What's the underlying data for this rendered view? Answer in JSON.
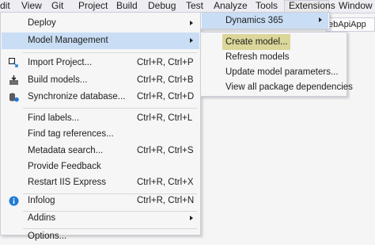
{
  "menubar": {
    "items": [
      "dit",
      "View",
      "Git",
      "Project",
      "Build",
      "Debug",
      "Test",
      "Analyze",
      "Tools",
      "Extensions",
      "Window"
    ],
    "active": "Extensions"
  },
  "background_tab": "ebApiApp",
  "main_menu": {
    "items": [
      {
        "label": "Deploy",
        "shortcut": "",
        "submenu": true
      },
      {
        "label": "Model Management",
        "shortcut": "",
        "submenu": true
      },
      {
        "label": "Import Project...",
        "shortcut": "Ctrl+R, Ctrl+P",
        "icon": "import-project-icon"
      },
      {
        "label": "Build models...",
        "shortcut": "Ctrl+R, Ctrl+B",
        "icon": "build-models-icon"
      },
      {
        "label": "Synchronize database...",
        "shortcut": "Ctrl+R, Ctrl+D",
        "icon": "synchronize-database-icon"
      },
      {
        "label": "Find labels...",
        "shortcut": "Ctrl+R, Ctrl+L"
      },
      {
        "label": "Find tag references...",
        "shortcut": ""
      },
      {
        "label": "Metadata search...",
        "shortcut": "Ctrl+R, Ctrl+S"
      },
      {
        "label": "Provide Feedback",
        "shortcut": ""
      },
      {
        "label": "Restart IIS Express",
        "shortcut": "Ctrl+R, Ctrl+X"
      },
      {
        "label": "Infolog",
        "shortcut": "Ctrl+R, Ctrl+N",
        "icon": "info-icon"
      },
      {
        "label": "Addins",
        "shortcut": "",
        "submenu": true
      },
      {
        "label": "Options...",
        "shortcut": ""
      }
    ]
  },
  "dynamics_menu": {
    "label": "Dynamics 365"
  },
  "model_menu": {
    "items": [
      "Create model...",
      "Refresh models",
      "Update model parameters...",
      "View all package dependencies"
    ]
  },
  "colors": {
    "highlight": "#c9def5",
    "selection": "#d1cb7a",
    "info_blue": "#1e7bd8"
  }
}
